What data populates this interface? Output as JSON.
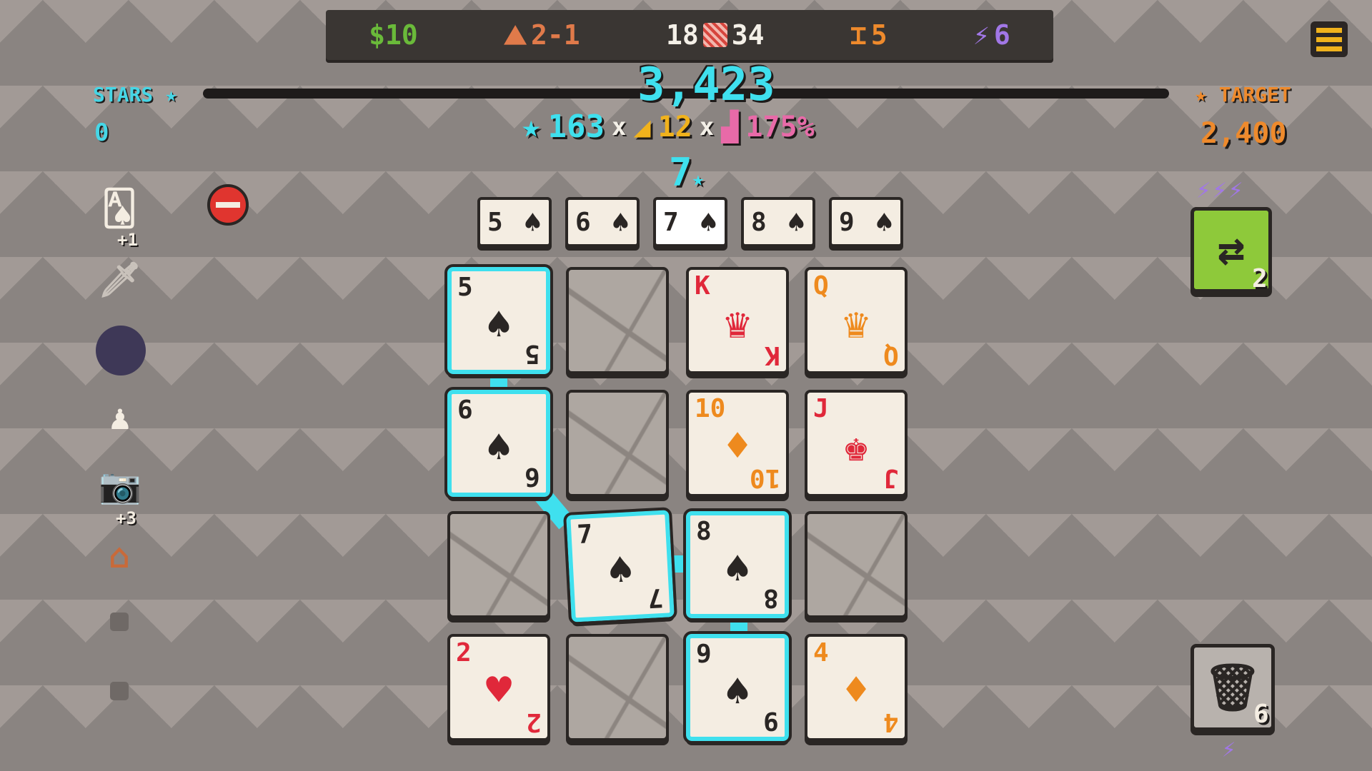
{
  "topbar": {
    "money": "$10",
    "round": "2-1",
    "deck_remaining": "18",
    "deck_total": "34",
    "hands": "5",
    "energy": "6"
  },
  "progress": {
    "stars_label": "STARS",
    "stars_value": "0",
    "target_label": "TARGET",
    "target_value": "2,400",
    "current_score": "3,423"
  },
  "scoring": {
    "chips": "163",
    "mult": "12",
    "percent": "175%",
    "x_symbol": "x",
    "level": "7"
  },
  "hand_preview": [
    {
      "rank": "5",
      "suit": "♠"
    },
    {
      "rank": "6",
      "suit": "♠"
    },
    {
      "rank": "7",
      "suit": "♠"
    },
    {
      "rank": "8",
      "suit": "♠"
    },
    {
      "rank": "9",
      "suit": "♠"
    }
  ],
  "grid": {
    "cards": [
      {
        "rank": "5",
        "suit": "♠",
        "color": "#2a2624"
      },
      {
        "rank": "K",
        "suit": "♥",
        "color": "#e0283a"
      },
      {
        "rank": "Q",
        "suit": "♦",
        "color": "#ee8a1e"
      },
      {
        "rank": "6",
        "suit": "♠",
        "color": "#2a2624"
      },
      {
        "rank": "10",
        "suit": "♦",
        "color": "#ee8a1e"
      },
      {
        "rank": "J",
        "suit": "♥",
        "color": "#e0283a"
      },
      {
        "rank": "7",
        "suit": "♠",
        "color": "#2a2624"
      },
      {
        "rank": "8",
        "suit": "♠",
        "color": "#2a2624"
      },
      {
        "rank": "2",
        "suit": "♥",
        "color": "#e0283a"
      },
      {
        "rank": "9",
        "suit": "♠",
        "color": "#2a2624"
      },
      {
        "rank": "4",
        "suit": "♦",
        "color": "#ee8a1e"
      }
    ]
  },
  "relics": {
    "card_bonus": "+1",
    "camera_bonus": "+3"
  },
  "actions": {
    "swap_count": "2",
    "trash_count": "6"
  },
  "icons": {
    "round": "hat-icon",
    "hands": "hands-icon",
    "energy": "lightning-icon",
    "menu": "hamburger-icon",
    "swap": "swap-icon",
    "trash": "trash-icon"
  }
}
